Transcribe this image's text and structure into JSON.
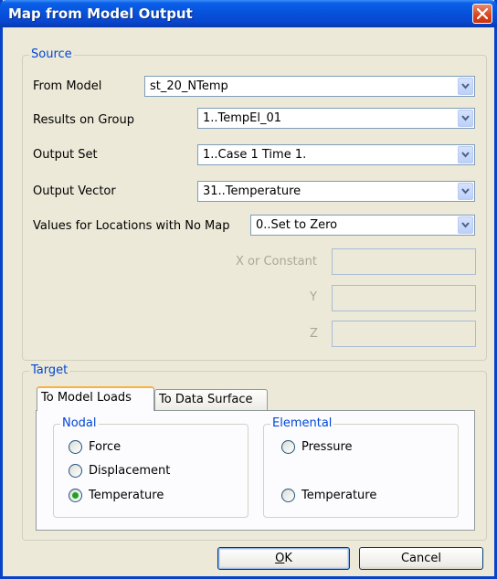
{
  "window": {
    "title": "Map from Model Output",
    "close_icon": "close-icon"
  },
  "source": {
    "legend": "Source",
    "from_model": {
      "label": "From Model",
      "value": "st_20_NTemp"
    },
    "results_on_group": {
      "label": "Results on Group",
      "value": "1..TempEl_01"
    },
    "output_set": {
      "label": "Output Set",
      "value": "1..Case 1 Time 1."
    },
    "output_vector": {
      "label": "Output Vector",
      "value": "31..Temperature"
    },
    "no_map": {
      "label": "Values for Locations with No Map",
      "value": "0..Set to Zero"
    },
    "x_label": "X or Constant",
    "y_label": "Y",
    "z_label": "Z"
  },
  "target": {
    "legend": "Target",
    "tabs": [
      {
        "label": "To Model Loads"
      },
      {
        "label": "To Data Surface"
      }
    ],
    "nodal": {
      "legend": "Nodal",
      "options": [
        {
          "label": "Force"
        },
        {
          "label": "Displacement"
        },
        {
          "label": "Temperature"
        }
      ]
    },
    "elemental": {
      "legend": "Elemental",
      "options": [
        {
          "label": "Pressure"
        },
        {
          "label": "Temperature"
        }
      ]
    }
  },
  "buttons": {
    "ok_mnemonic": "O",
    "ok_rest": "K",
    "cancel": "Cancel"
  }
}
